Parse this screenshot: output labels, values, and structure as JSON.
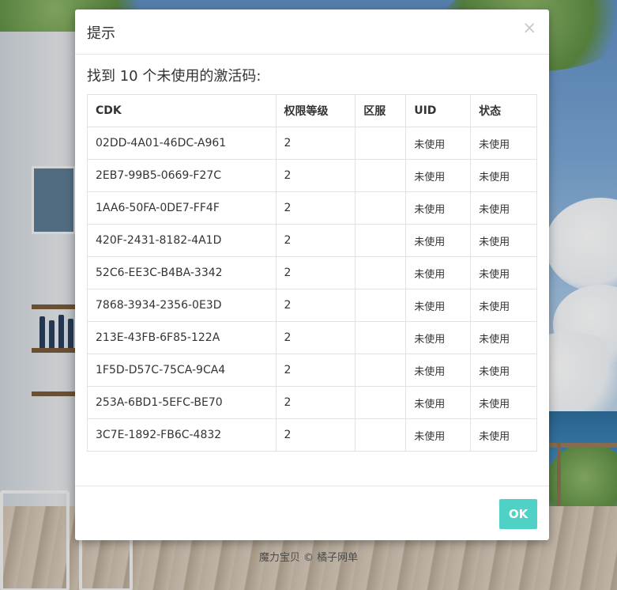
{
  "dialog": {
    "title": "提示",
    "close_symbol": "×",
    "message": "找到 10 个未使用的激活码:",
    "ok_label": "OK"
  },
  "table": {
    "headers": [
      "CDK",
      "权限等级",
      "区服",
      "UID",
      "状态"
    ],
    "rows": [
      [
        "02DD-4A01-46DC-A961",
        "2",
        "",
        "未使用",
        "未使用"
      ],
      [
        "2EB7-99B5-0669-F27C",
        "2",
        "",
        "未使用",
        "未使用"
      ],
      [
        "1AA6-50FA-0DE7-FF4F",
        "2",
        "",
        "未使用",
        "未使用"
      ],
      [
        "420F-2431-8182-4A1D",
        "2",
        "",
        "未使用",
        "未使用"
      ],
      [
        "52C6-EE3C-B4BA-3342",
        "2",
        "",
        "未使用",
        "未使用"
      ],
      [
        "7868-3934-2356-0E3D",
        "2",
        "",
        "未使用",
        "未使用"
      ],
      [
        "213E-43FB-6F85-122A",
        "2",
        "",
        "未使用",
        "未使用"
      ],
      [
        "1F5D-D57C-75CA-9CA4",
        "2",
        "",
        "未使用",
        "未使用"
      ],
      [
        "253A-6BD1-5EFC-BE70",
        "2",
        "",
        "未使用",
        "未使用"
      ],
      [
        "3C7E-1892-FB6C-4832",
        "2",
        "",
        "未使用",
        "未使用"
      ]
    ]
  },
  "footer": {
    "text": "魔力宝贝 © 橘子网单"
  },
  "colors": {
    "ok_button": "#4fd1c5",
    "text": "#333333",
    "border": "#e2e2e2"
  }
}
